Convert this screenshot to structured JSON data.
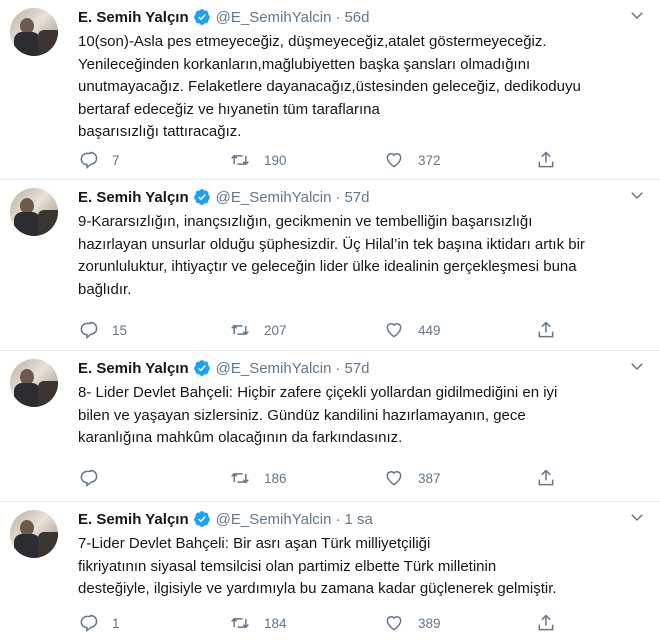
{
  "tweets": [
    {
      "name": "E. Semih Yalçın",
      "handle": "@E_SemihYalcin",
      "separator": "·",
      "time": "56d",
      "text": "10(son)-Asla pes etmeyeceğiz, düşmeyeceğiz,atalet göstermeyeceğiz.\nYenileceğinden korkanların,mağlubiyetten başka şansları olmadığını\nunutmayacağız. Felaketlere dayanacağız,üstesinden geleceğiz, dedikoduyu\nbertaraf edeceğiz ve hıyanetin tüm taraflarına\nbaşarısızlığı tattıracağız.",
      "replies": "7",
      "retweets": "190",
      "likes": "372"
    },
    {
      "name": "E. Semih Yalçın",
      "handle": "@E_SemihYalcin",
      "separator": "·",
      "time": "57d",
      "text": "9-Kararsızlığın, inançsızlığın, gecikmenin ve tembelliğin başarısızlığı\nhazırlayan unsurlar olduğu şüphesizdir. Üç Hilal’in tek başına iktidarı artık bir\nzorunluluktur, ihtiyaçtır ve geleceğin lider ülke idealinin gerçekleşmesi buna\nbağlıdır.",
      "replies": "15",
      "retweets": "207",
      "likes": "449"
    },
    {
      "name": "E. Semih Yalçın",
      "handle": "@E_SemihYalcin",
      "separator": "·",
      "time": "57d",
      "text": "8- Lider Devlet Bahçeli: Hiçbir zafere çiçekli yollardan gidilmediğini en iyi\nbilen ve yaşayan sizlersiniz. Gündüz kandilini hazırlamayanın, gece\nkaranlığına mahkûm olacağının da farkındasınız.",
      "replies": "",
      "retweets": "186",
      "likes": "387"
    },
    {
      "name": "E. Semih Yalçın",
      "handle": "@E_SemihYalcin",
      "separator": "·",
      "time": "1 sa",
      "text": "7-Lider Devlet Bahçeli: Bir asrı aşan Türk milliyetçiliği\nfikriyatının siyasal temsilcisi olan partimiz elbette Türk milletinin\ndesteğiyle, ilgisiyle ve yardımıyla bu zamana kadar güçlenerek gelmiştir.",
      "replies": "1",
      "retweets": "184",
      "likes": "389"
    }
  ],
  "icons": {
    "verified": "verified-badge-icon",
    "caret": "chevron-down-icon",
    "reply": "reply-icon",
    "retweet": "retweet-icon",
    "like": "heart-icon",
    "share": "share-icon"
  },
  "colors": {
    "text": "#14171a",
    "secondary": "#657786",
    "verified": "#1da1f2",
    "divider": "#e6ecf0"
  }
}
